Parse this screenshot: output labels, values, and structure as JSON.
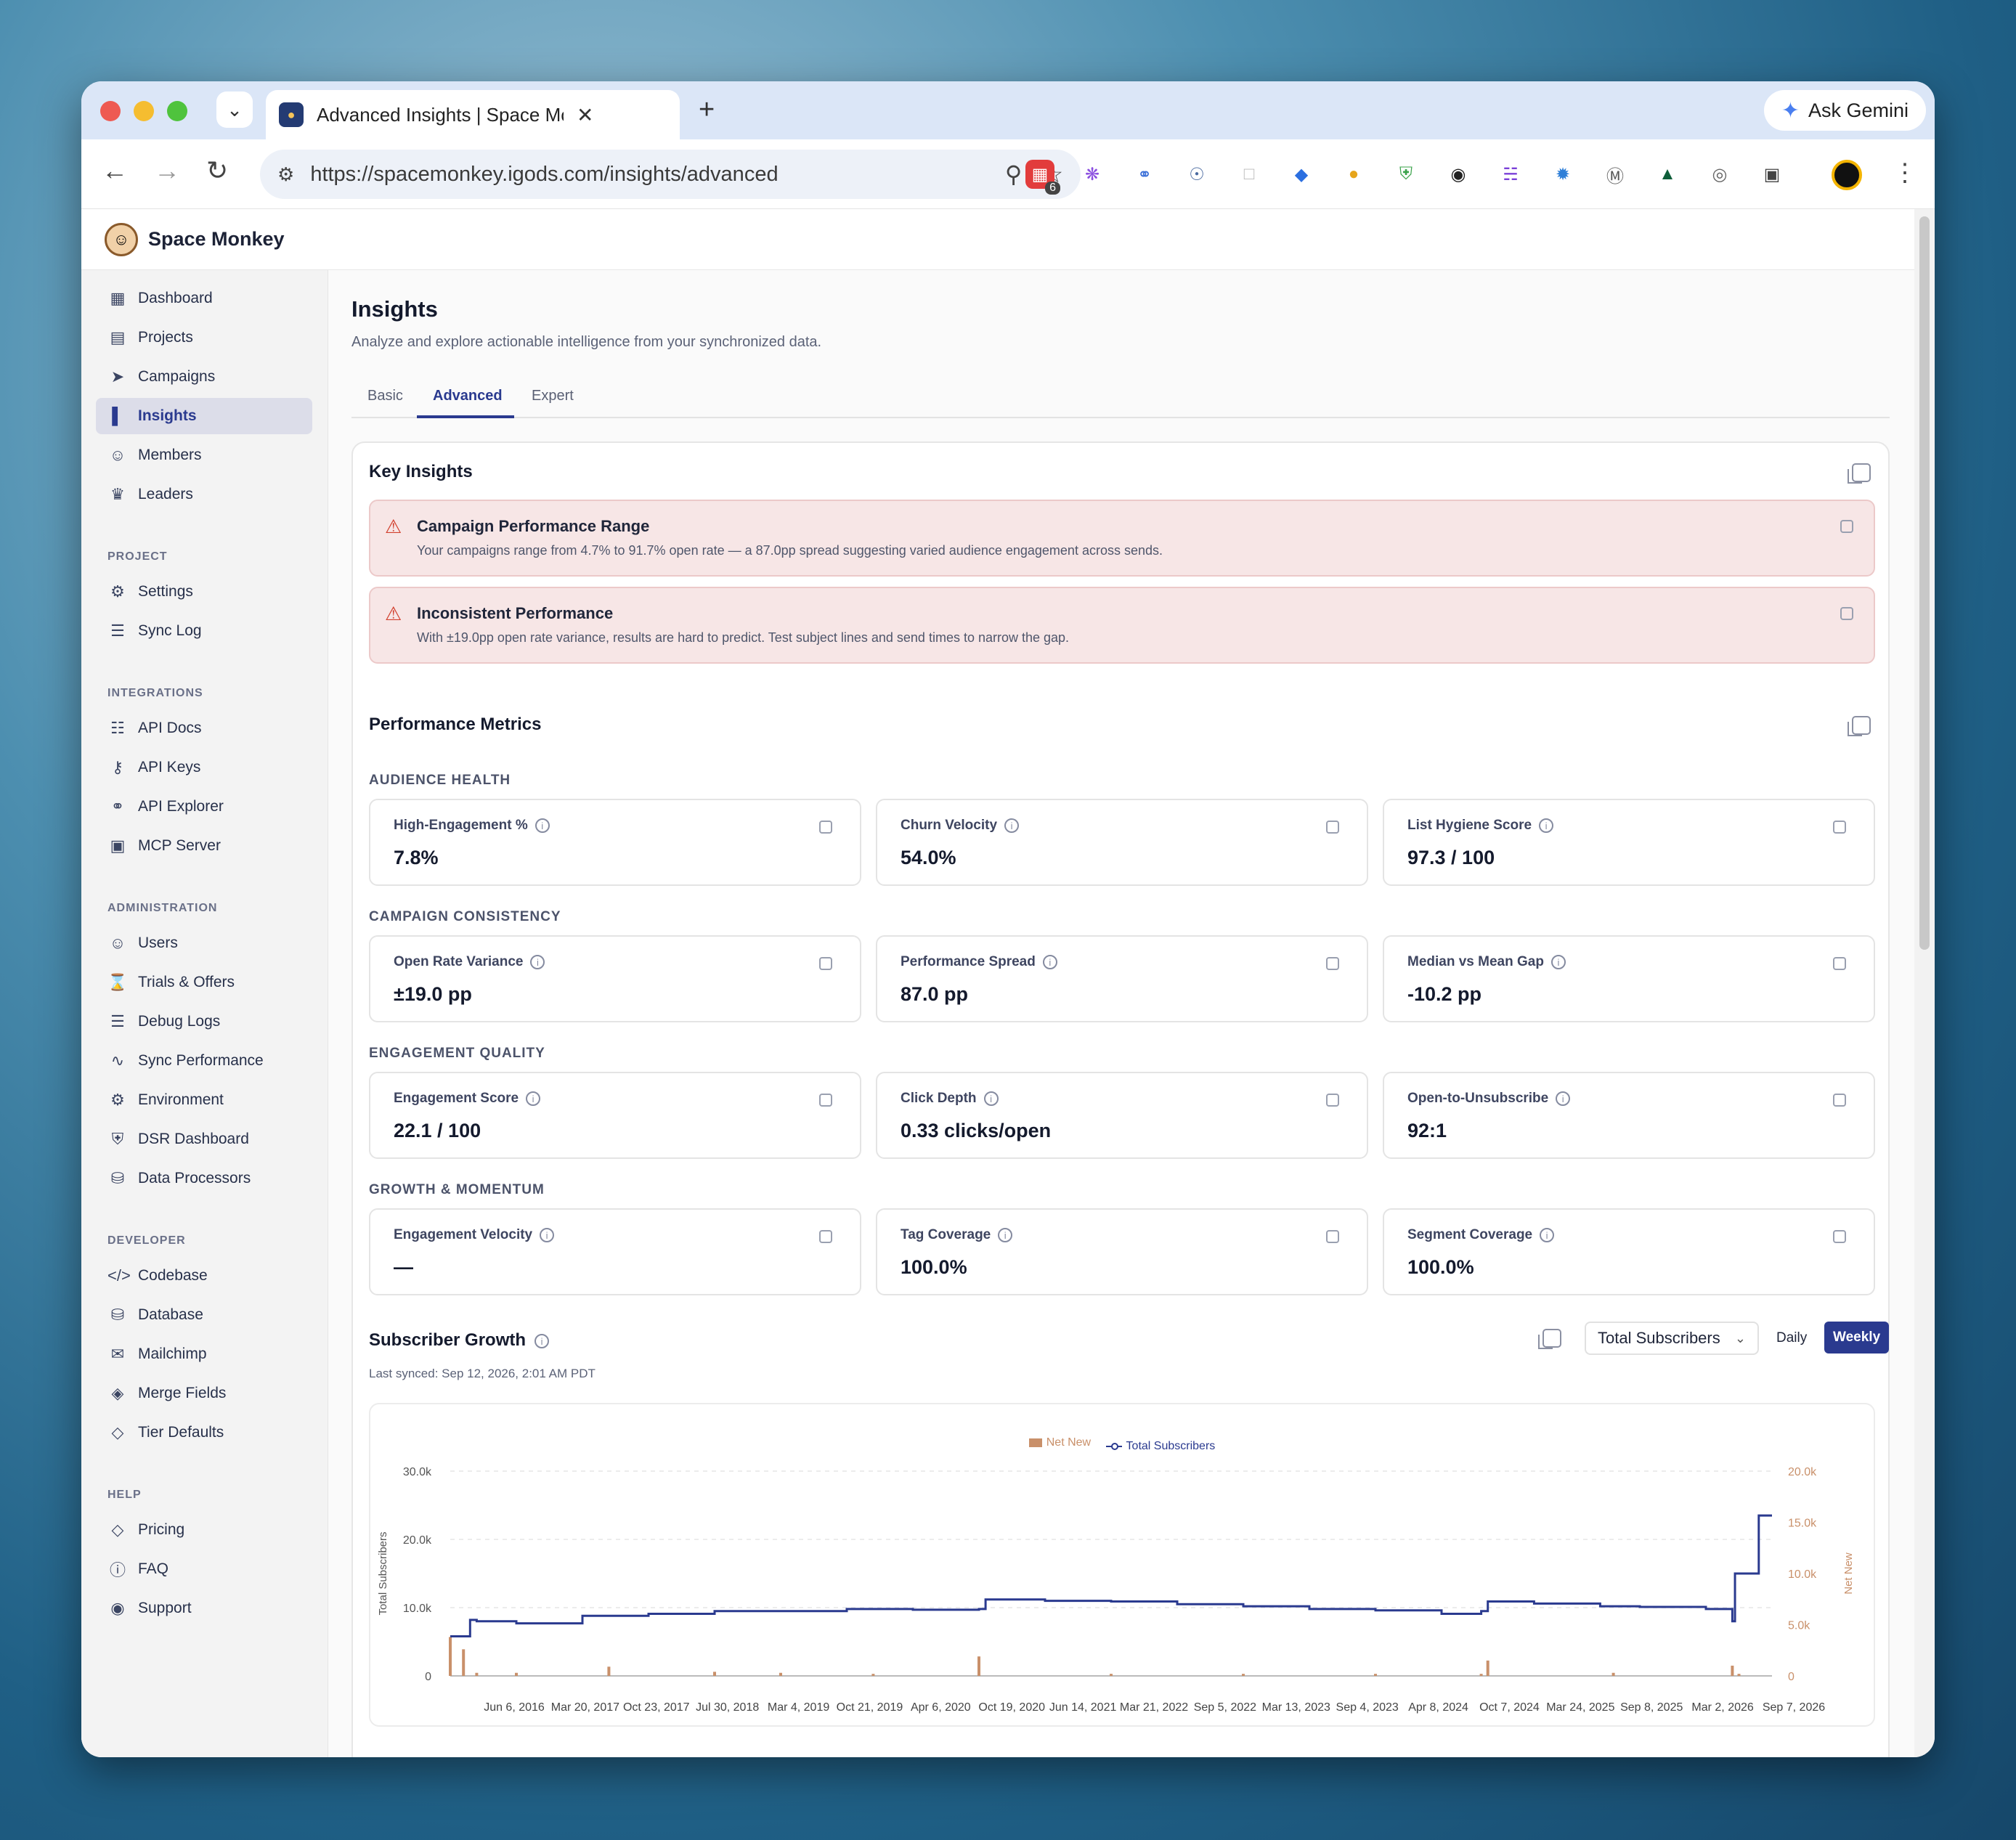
{
  "browser": {
    "tab_title": "Advanced Insights | Space Mo",
    "url": "https://spacemonkey.igods.com/insights/advanced",
    "gemini_label": "Ask Gemini",
    "ext_badge": "6"
  },
  "brand": {
    "name": "Space Monkey"
  },
  "sidebar": {
    "main": [
      {
        "label": "Dashboard",
        "icon": "dashboard-icon"
      },
      {
        "label": "Projects",
        "icon": "building-icon"
      },
      {
        "label": "Campaigns",
        "icon": "send-icon"
      },
      {
        "label": "Insights",
        "icon": "bar-chart-icon",
        "active": true
      },
      {
        "label": "Members",
        "icon": "users-icon"
      },
      {
        "label": "Leaders",
        "icon": "crown-icon"
      }
    ],
    "sections": {
      "project": "PROJECT",
      "integrations": "INTEGRATIONS",
      "administration": "ADMINISTRATION",
      "developer": "DEVELOPER",
      "help": "HELP"
    },
    "project": [
      {
        "label": "Settings",
        "icon": "gear-icon"
      },
      {
        "label": "Sync Log",
        "icon": "log-icon"
      }
    ],
    "integrations": [
      {
        "label": "API Docs",
        "icon": "book-icon"
      },
      {
        "label": "API Keys",
        "icon": "key-icon"
      },
      {
        "label": "API Explorer",
        "icon": "globe-icon"
      },
      {
        "label": "MCP Server",
        "icon": "server-icon"
      }
    ],
    "administration": [
      {
        "label": "Users",
        "icon": "users-icon"
      },
      {
        "label": "Trials & Offers",
        "icon": "hourglass-icon"
      },
      {
        "label": "Debug Logs",
        "icon": "log-icon"
      },
      {
        "label": "Sync Performance",
        "icon": "activity-icon"
      },
      {
        "label": "Environment",
        "icon": "gear-icon"
      },
      {
        "label": "DSR Dashboard",
        "icon": "shield-icon"
      },
      {
        "label": "Data Processors",
        "icon": "database-icon"
      }
    ],
    "developer": [
      {
        "label": "Codebase",
        "icon": "code-icon"
      },
      {
        "label": "Database",
        "icon": "database-icon"
      },
      {
        "label": "Mailchimp",
        "icon": "mail-icon"
      },
      {
        "label": "Merge Fields",
        "icon": "tags-icon"
      },
      {
        "label": "Tier Defaults",
        "icon": "tag-icon"
      }
    ],
    "help": [
      {
        "label": "Pricing",
        "icon": "tag-icon"
      },
      {
        "label": "FAQ",
        "icon": "question-icon"
      },
      {
        "label": "Support",
        "icon": "lifebuoy-icon"
      }
    ]
  },
  "page": {
    "title": "Insights",
    "subtitle": "Analyze and explore actionable intelligence from your synchronized data.",
    "tabs": [
      "Basic",
      "Advanced",
      "Expert"
    ],
    "active_tab": "Advanced"
  },
  "key_insights": {
    "title": "Key Insights",
    "alerts": [
      {
        "title": "Campaign Performance Range",
        "desc": "Your campaigns range from 4.7% to 91.7% open rate — a 87.0pp spread suggesting varied audience engagement across sends."
      },
      {
        "title": "Inconsistent Performance",
        "desc": "With ±19.0pp open rate variance, results are hard to predict. Test subject lines and send times to narrow the gap."
      }
    ]
  },
  "performance": {
    "title": "Performance Metrics",
    "groups": [
      {
        "label": "AUDIENCE HEALTH",
        "metrics": [
          {
            "label": "High-Engagement %",
            "value": "7.8%"
          },
          {
            "label": "Churn Velocity",
            "value": "54.0%"
          },
          {
            "label": "List Hygiene Score",
            "value": "97.3 / 100"
          }
        ]
      },
      {
        "label": "CAMPAIGN CONSISTENCY",
        "metrics": [
          {
            "label": "Open Rate Variance",
            "value": "±19.0 pp"
          },
          {
            "label": "Performance Spread",
            "value": "87.0 pp"
          },
          {
            "label": "Median vs Mean Gap",
            "value": "-10.2 pp"
          }
        ]
      },
      {
        "label": "ENGAGEMENT QUALITY",
        "metrics": [
          {
            "label": "Engagement Score",
            "value": "22.1 / 100"
          },
          {
            "label": "Click Depth",
            "value": "0.33 clicks/open"
          },
          {
            "label": "Open-to-Unsubscribe",
            "value": "92:1"
          }
        ]
      },
      {
        "label": "GROWTH & MOMENTUM",
        "metrics": [
          {
            "label": "Engagement Velocity",
            "value": "—"
          },
          {
            "label": "Tag Coverage",
            "value": "100.0%"
          },
          {
            "label": "Segment Coverage",
            "value": "100.0%"
          }
        ]
      }
    ]
  },
  "growth": {
    "title": "Subscriber Growth",
    "synced": "Last synced: Sep 12, 2026, 2:01 AM PDT",
    "select_value": "Total Subscribers",
    "toggle": [
      "Daily",
      "Weekly"
    ],
    "active_toggle": "Weekly"
  },
  "chart_data": {
    "type": "line",
    "legend": [
      "Net New",
      "Total Subscribers"
    ],
    "ylabel": "Total Subscribers",
    "y2label": "Net New",
    "ylim": [
      0,
      30000
    ],
    "y2lim": [
      0,
      20000
    ],
    "yticks": [
      "0",
      "10.0k",
      "20.0k",
      "30.0k"
    ],
    "y2ticks": [
      "0",
      "5.0k",
      "10.0k",
      "15.0k",
      "20.0k"
    ],
    "x_labels": [
      "Jun 6, 2016",
      "Mar 20, 2017",
      "Oct 23, 2017",
      "Jul 30, 2018",
      "Mar 4, 2019",
      "Oct 21, 2019",
      "Apr 6, 2020",
      "Oct 19, 2020",
      "Jun 14, 2021",
      "Mar 21, 2022",
      "Sep 5, 2022",
      "Mar 13, 2023",
      "Sep 4, 2023",
      "Apr 8, 2024",
      "Oct 7, 2024",
      "Mar 24, 2025",
      "Sep 8, 2025",
      "Mar 2, 2026",
      "Sep 7, 2026"
    ],
    "series": [
      {
        "name": "Total Subscribers",
        "axis": "left",
        "t": [
          0.0,
          0.01,
          0.015,
          0.02,
          0.05,
          0.1,
          0.15,
          0.2,
          0.25,
          0.3,
          0.35,
          0.4,
          0.405,
          0.45,
          0.5,
          0.55,
          0.6,
          0.65,
          0.7,
          0.75,
          0.78,
          0.785,
          0.82,
          0.87,
          0.9,
          0.95,
          0.97,
          0.972,
          0.99,
          1.0
        ],
        "values": [
          5800,
          5800,
          8200,
          8000,
          7700,
          8800,
          9100,
          9500,
          9500,
          9800,
          9700,
          9800,
          11200,
          11000,
          10900,
          10500,
          10200,
          9800,
          9600,
          9100,
          9500,
          10900,
          10600,
          10200,
          10100,
          9800,
          8000,
          15000,
          23500,
          23500
        ]
      },
      {
        "name": "Net New",
        "axis": "right",
        "spikes_t": [
          0.0,
          0.01,
          0.02,
          0.05,
          0.12,
          0.2,
          0.25,
          0.32,
          0.4,
          0.5,
          0.6,
          0.7,
          0.78,
          0.785,
          0.88,
          0.97,
          0.975
        ],
        "values": [
          3800,
          2600,
          300,
          300,
          900,
          400,
          300,
          200,
          1900,
          200,
          200,
          200,
          200,
          1500,
          300,
          1000,
          200
        ]
      }
    ]
  }
}
